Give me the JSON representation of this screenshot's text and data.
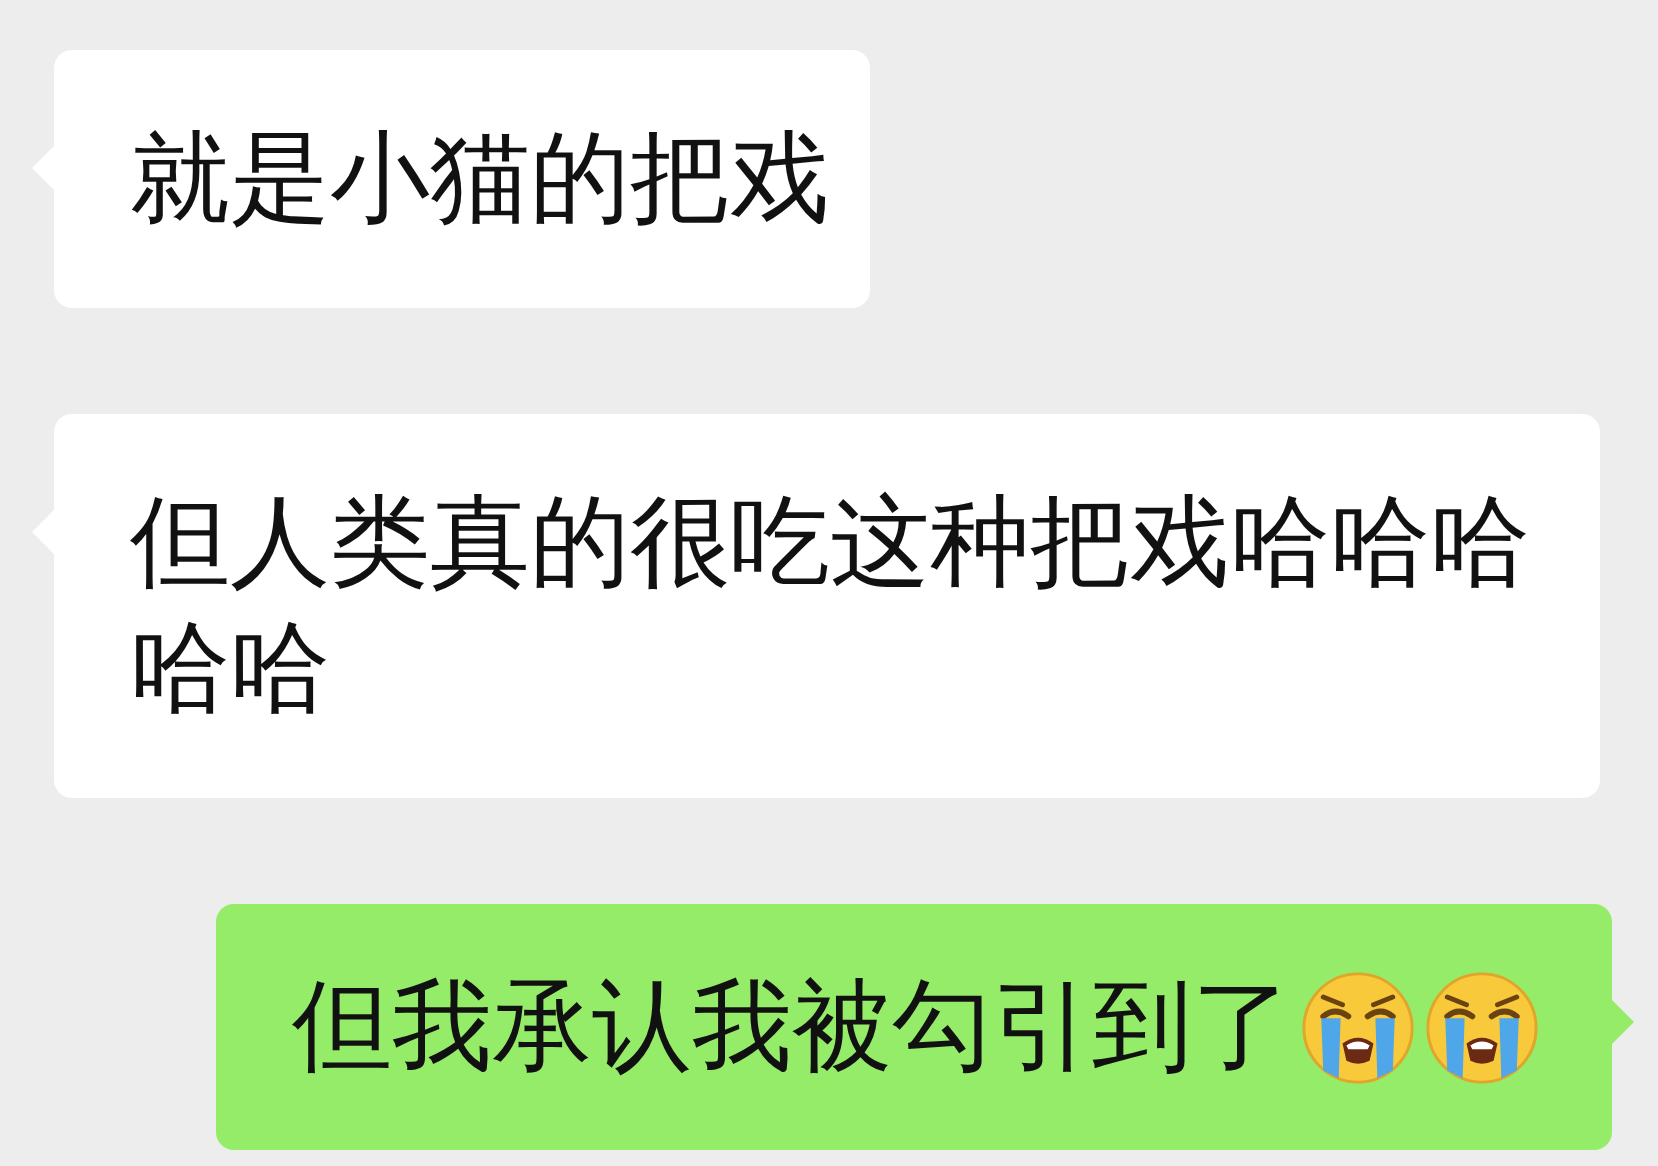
{
  "messages": [
    {
      "kind": "received",
      "text": "就是小猫的把戏"
    },
    {
      "kind": "received",
      "text": "但人类真的很吃这种把戏哈哈哈哈哈"
    },
    {
      "kind": "sent",
      "text": "但我承认我被勾引到了",
      "emojis": [
        {
          "kind": "crying"
        },
        {
          "kind": "crying"
        }
      ]
    }
  ]
}
